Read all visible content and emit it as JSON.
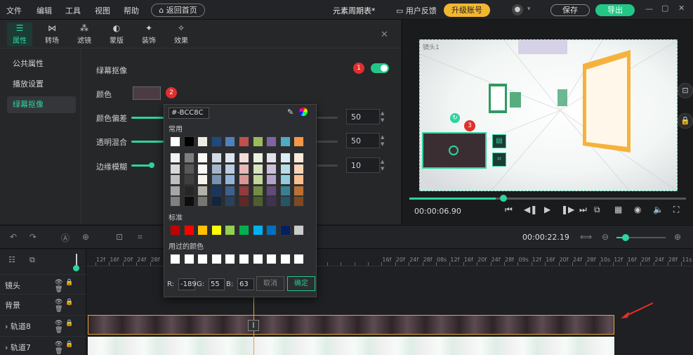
{
  "menu": [
    "文件",
    "编辑",
    "工具",
    "视图",
    "帮助"
  ],
  "home_button": "返回首页",
  "doc_title": "元素周期表*",
  "feedback": "用户反馈",
  "upgrade": "升级账号",
  "save": "保存",
  "export": "导出",
  "tabs": [
    {
      "label": "属性",
      "icon": "sliders-icon"
    },
    {
      "label": "转场",
      "icon": "transition-icon"
    },
    {
      "label": "滤镜",
      "icon": "filter-icon"
    },
    {
      "label": "蒙版",
      "icon": "mask-icon"
    },
    {
      "label": "装饰",
      "icon": "decoration-icon"
    },
    {
      "label": "效果",
      "icon": "effect-icon"
    }
  ],
  "side_items": [
    "公共属性",
    "播放设置",
    "绿幕抠像"
  ],
  "props": {
    "chroma_label": "绿幕抠像",
    "color_label": "颜色",
    "offset_label": "颜色偏差",
    "offset_value": "50",
    "blend_label": "透明混合",
    "blend_value": "50",
    "edge_label": "边缘模糊",
    "edge_value": "10"
  },
  "badges": [
    "1",
    "2",
    "3"
  ],
  "picker": {
    "hex": "#-BCC8C",
    "common_label": "常用",
    "standard_label": "标准",
    "recent_label": "用过的颜色",
    "r_label": "R:",
    "r": "-189",
    "g_label": "G:",
    "g": "55",
    "b_label": "B:",
    "b": "63",
    "cancel": "取消",
    "ok": "确定",
    "common_top": [
      "#ffffff",
      "#000000",
      "#eeece1",
      "#1f497d",
      "#4f81bd",
      "#c0504d",
      "#9bbb59",
      "#8064a2",
      "#4bacc6",
      "#f79646"
    ],
    "standard": [
      "#c00000",
      "#ff0000",
      "#ffc000",
      "#ffff00",
      "#92d050",
      "#00b050",
      "#00b0f0",
      "#0070c0",
      "#002060",
      "#cccccc"
    ]
  },
  "preview": {
    "camera_label": "镜头1",
    "time_current": "00:00:06.90",
    "progress": 0.33
  },
  "toolbar": {
    "duration": "00:00:22.19"
  },
  "ruler_ticks": [
    "12f",
    "16f",
    "20f",
    "24f",
    "28f",
    "",
    "12f",
    "16f",
    "20f",
    "24f",
    "28f",
    "",
    "",
    "",
    "",
    "",
    "",
    "",
    "",
    "",
    "",
    "16f",
    "20f",
    "24f",
    "28f",
    "08s",
    "12f",
    "16f",
    "20f",
    "24f",
    "28f",
    "09s",
    "12f",
    "16f",
    "20f",
    "24f",
    "28f",
    "10s",
    "12f",
    "16f",
    "20f",
    "24f",
    "28f",
    "11s"
  ],
  "tracks": [
    "镜头",
    "背景",
    "轨道8",
    "轨道7"
  ],
  "colors": {
    "accent": "#22c787",
    "upgrade": "#f2b731",
    "badge": "#e0302d",
    "playhead": "#e2a43a"
  }
}
